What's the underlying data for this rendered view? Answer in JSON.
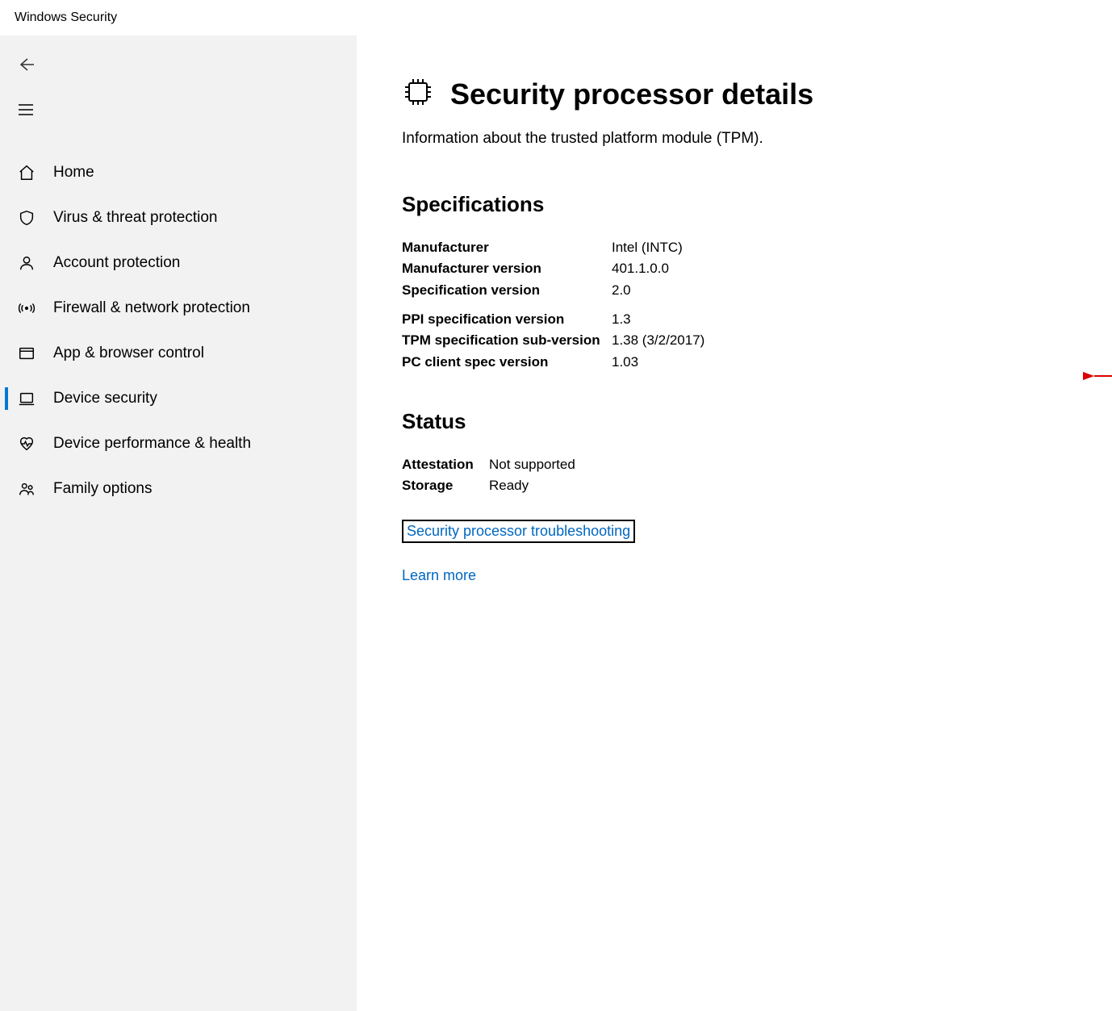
{
  "window": {
    "title": "Windows Security"
  },
  "sidebar": {
    "items": [
      {
        "label": "Home"
      },
      {
        "label": "Virus & threat protection"
      },
      {
        "label": "Account protection"
      },
      {
        "label": "Firewall & network protection"
      },
      {
        "label": "App & browser control"
      },
      {
        "label": "Device security"
      },
      {
        "label": "Device performance & health"
      },
      {
        "label": "Family options"
      }
    ],
    "selected_index": 5
  },
  "main": {
    "title": "Security processor details",
    "subtitle": "Information about the trusted platform module (TPM).",
    "sections": {
      "specifications": {
        "heading": "Specifications",
        "group1": [
          {
            "label": "Manufacturer",
            "value": "Intel (INTC)"
          },
          {
            "label": "Manufacturer version",
            "value": "401.1.0.0"
          },
          {
            "label": "Specification version",
            "value": "2.0"
          }
        ],
        "group2": [
          {
            "label": "PPI specification version",
            "value": "1.3"
          },
          {
            "label": "TPM specification sub-version",
            "value": "1.38 (3/2/2017)"
          },
          {
            "label": "PC client spec version",
            "value": "1.03"
          }
        ]
      },
      "status": {
        "heading": "Status",
        "rows": [
          {
            "label": "Attestation",
            "value": "Not supported"
          },
          {
            "label": "Storage",
            "value": "Ready"
          }
        ]
      }
    },
    "links": {
      "troubleshooting": "Security processor troubleshooting",
      "learn_more": "Learn more"
    }
  }
}
